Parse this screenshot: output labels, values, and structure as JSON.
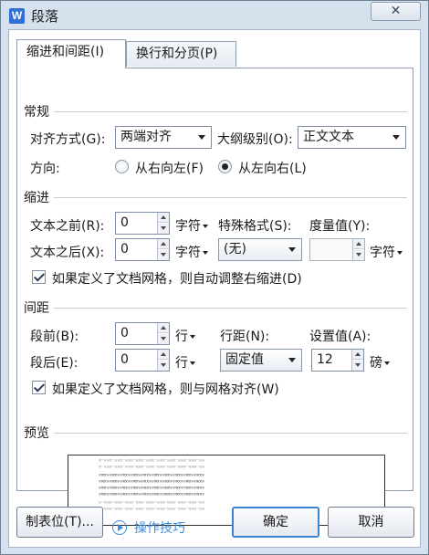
{
  "window": {
    "title": "段落",
    "app_icon": "W",
    "close_glyph": "✕"
  },
  "tabs": [
    {
      "label": "缩进和间距(I)",
      "active": true
    },
    {
      "label": "换行和分页(P)",
      "active": false
    }
  ],
  "general": {
    "section_title": "常规",
    "alignment_label": "对齐方式(G):",
    "alignment_value": "两端对齐",
    "outline_label": "大纲级别(O):",
    "outline_value": "正文文本",
    "direction_label": "方向:",
    "rtl_label": "从右向左(F)",
    "ltr_label": "从左向右(L)",
    "direction_selected": "ltr"
  },
  "indent": {
    "section_title": "缩进",
    "before_label": "文本之前(R):",
    "before_value": "0",
    "before_unit": "字符",
    "after_label": "文本之后(X):",
    "after_value": "0",
    "after_unit": "字符",
    "special_label": "特殊格式(S):",
    "special_value": "(无)",
    "measure_label": "度量值(Y):",
    "measure_value": "",
    "measure_unit": "字符",
    "grid_checkbox_label": "如果定义了文档网格，则自动调整右缩进(D)",
    "grid_checked": true
  },
  "spacing": {
    "section_title": "间距",
    "before_label": "段前(B):",
    "before_value": "0",
    "before_unit": "行",
    "after_label": "段后(E):",
    "after_value": "0",
    "after_unit": "行",
    "line_spacing_label": "行距(N):",
    "line_spacing_value": "固定值",
    "set_value_label": "设置值(A):",
    "set_value": "12",
    "set_value_unit": "磅",
    "grid_checkbox_label": "如果定义了文档网格，则与网格对齐(W)",
    "grid_checked": true
  },
  "preview": {
    "section_title": "预览",
    "prev_para_line": "前一段落前一段落前一段落前一段落前一段落前一段落前一段落前一段落前一段落前一段落",
    "sample_line": "示例文字示例文字示例文字示例文字示例文字示例文字示例文字示例文字示例文字示例文字",
    "next_para_line": "后一段落后一段落后一段落后一段落后一段落后一段落后一段落后一段落后一段落后一段落"
  },
  "footer": {
    "tabs_button": "制表位(T)...",
    "tips_link": "操作技巧",
    "ok_button": "确定",
    "cancel_button": "取消"
  },
  "colors": {
    "link": "#3c8ede",
    "primary_border": "#3a84d6",
    "window_bg": "#d6e1ee"
  }
}
